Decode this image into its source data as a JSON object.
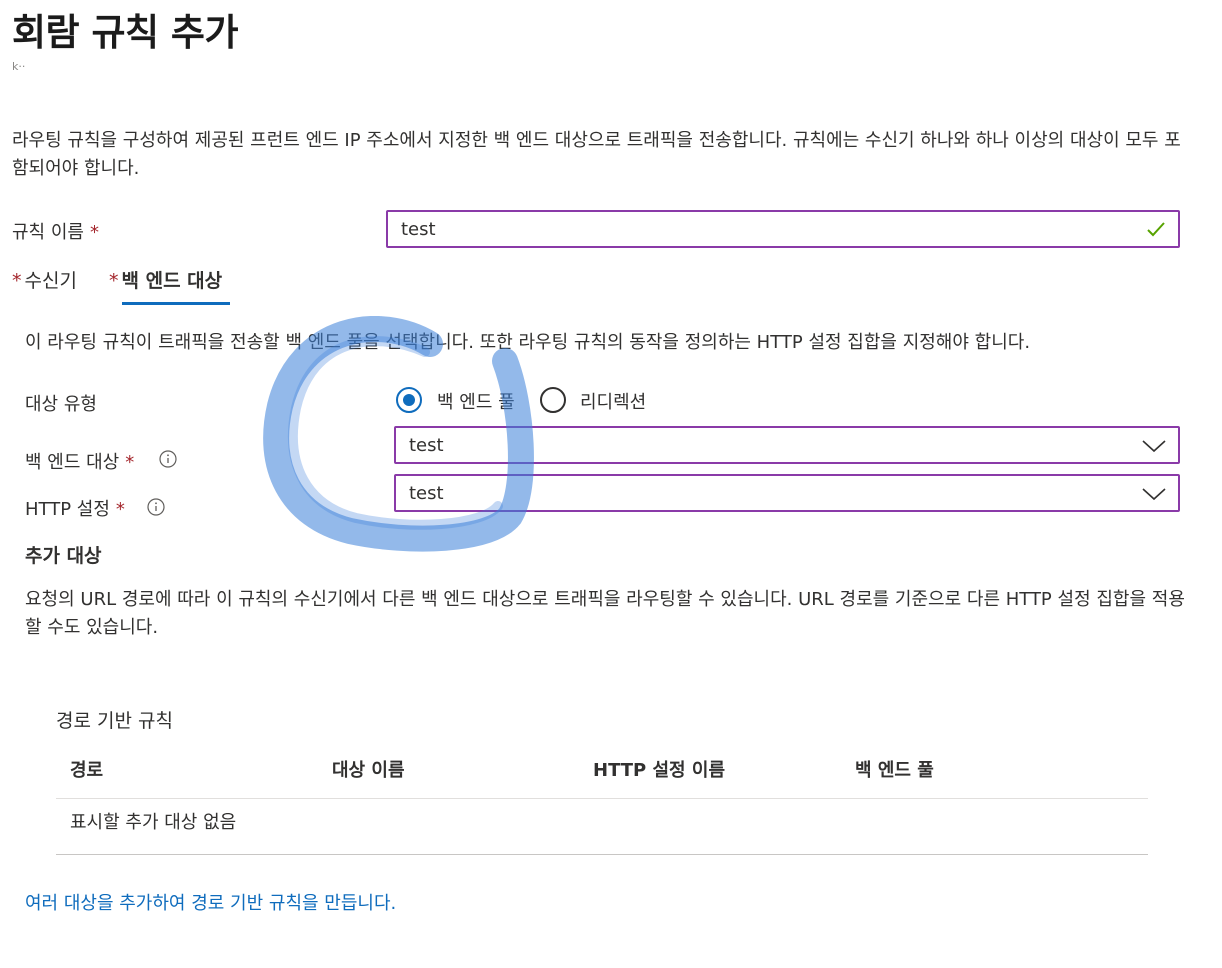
{
  "page": {
    "title": "회람 규칙 추가",
    "subtitle": "k··",
    "description": "라우팅 규칙을 구성하여 제공된 프런트 엔드 IP 주소에서 지정한 백 엔드 대상으로 트래픽을 전송합니다. 규칙에는 수신기 하나와 하나 이상의 대상이 모두 포함되어야 합니다."
  },
  "rule_name": {
    "label": "규칙 이름",
    "required_mark": "*",
    "value": "test"
  },
  "tabs": [
    {
      "label": "수신기",
      "required_mark": "*"
    },
    {
      "label": "백 엔드 대상",
      "required_mark": "*"
    }
  ],
  "backend": {
    "description": "이 라우팅 규칙이 트래픽을 전송할 백 엔드 풀을 선택합니다. 또한 라우팅 규칙의 동작을 정의하는 HTTP 설정 집합을 지정해야 합니다.",
    "target_type": {
      "label": "대상 유형",
      "options": [
        "백 엔드 풀",
        "리디렉션"
      ],
      "selected": "백 엔드 풀"
    },
    "backend_target": {
      "label": "백 엔드 대상",
      "required_mark": "*",
      "value": "test"
    },
    "http_settings": {
      "label": "HTTP 설정",
      "required_mark": "*",
      "value": "test"
    }
  },
  "additional_targets": {
    "title": "추가 대상",
    "description": "요청의 URL 경로에 따라 이 규칙의 수신기에서 다른 백 엔드 대상으로 트래픽을 라우팅할 수 있습니다. URL 경로를 기준으로 다른 HTTP 설정 집합을 적용할 수도 있습니다.",
    "grid_title": "경로 기반 규칙",
    "columns": [
      "경로",
      "대상 이름",
      "HTTP 설정 이름",
      "백 엔드 풀"
    ],
    "empty_message": "표시할 추가 대상 없음",
    "link": "여러 대상을 추가하여 경로 기반 규칙을 만듭니다."
  },
  "colors": {
    "accent": "#0f6cbd",
    "input_border": "#8a3aa8",
    "required": "#a4262c",
    "valid_check": "#57a300",
    "annotation_scribble": "#3a7fd9"
  }
}
